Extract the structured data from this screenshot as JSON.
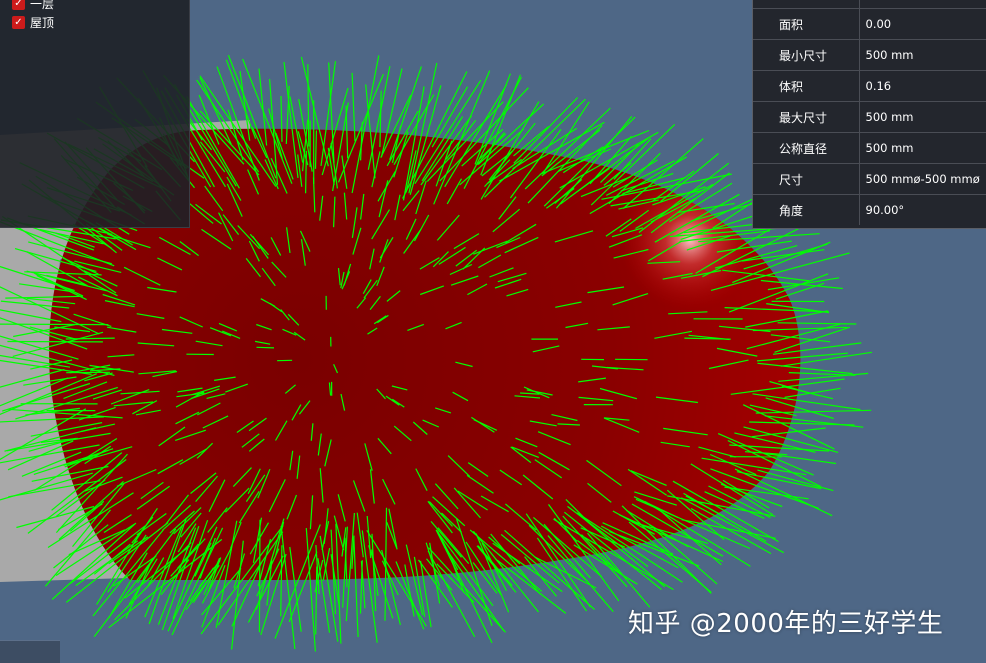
{
  "layers": [
    {
      "label": "一层",
      "checked": true
    },
    {
      "label": "屋顶",
      "checked": true
    }
  ],
  "properties": [
    {
      "key": "面积",
      "value": "0.00"
    },
    {
      "key": "最小尺寸",
      "value": "500 mm"
    },
    {
      "key": "体积",
      "value": "0.16"
    },
    {
      "key": "最大尺寸",
      "value": "500 mm"
    },
    {
      "key": "公称直径",
      "value": "500 mm"
    },
    {
      "key": "尺寸",
      "value": "500 mmø-500 mmø"
    },
    {
      "key": "角度",
      "value": "90.00°"
    }
  ],
  "watermark": "知乎 @2000年的三好学生",
  "colors": {
    "background": "#4e6786",
    "surface": "#8c0000",
    "normals": "#00ff00",
    "gray_slab": "#a9a9a9"
  },
  "icons": [
    "checkbox-icon",
    "axis-icon"
  ]
}
